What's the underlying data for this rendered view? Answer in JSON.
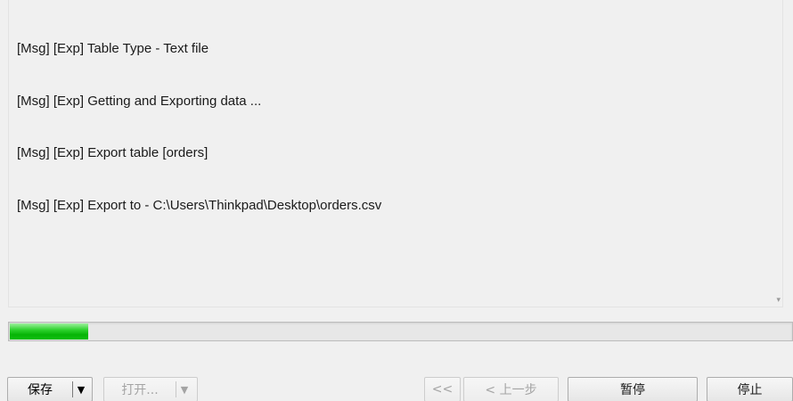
{
  "log": {
    "lines": [
      "[Msg] [Exp] Table Type - Text file",
      "[Msg] [Exp] Getting and Exporting data ...",
      "[Msg] [Exp] Export table [orders]",
      "[Msg] [Exp] Export to - C:\\Users\\Thinkpad\\Desktop\\orders.csv"
    ]
  },
  "progress": {
    "fraction": 0.1,
    "color": "#1cc41c"
  },
  "buttons": {
    "save_label": "保存",
    "save_arrow": "▼",
    "open_label": "打开...",
    "open_arrow": "▼",
    "first_label": "<<",
    "prev_label": "< 上一步",
    "pause_label": "暂停",
    "stop_label": "停止"
  },
  "icons": {
    "scroll_down": "scroll-down-arrow-icon",
    "dropdown": "chevron-down-icon"
  }
}
